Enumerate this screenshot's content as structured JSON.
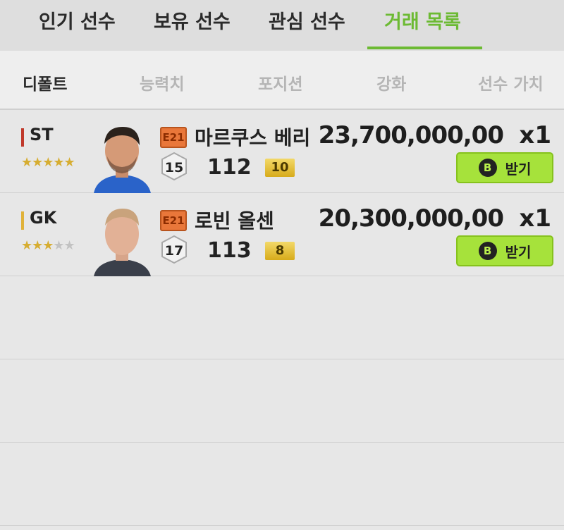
{
  "tabs": [
    {
      "label": "인기 선수",
      "active": false
    },
    {
      "label": "보유 선수",
      "active": false
    },
    {
      "label": "관심 선수",
      "active": false
    },
    {
      "label": "거래 목록",
      "active": true
    }
  ],
  "sort": [
    {
      "label": "디폴트",
      "active": true
    },
    {
      "label": "능력치",
      "active": false
    },
    {
      "label": "포지션",
      "active": false
    },
    {
      "label": "강화",
      "active": false
    },
    {
      "label": "선수 가치",
      "active": false
    }
  ],
  "colors": {
    "accent": "#6cba33",
    "button": "#a6e23b",
    "st": "#c0392b",
    "gk": "#e0b23a"
  },
  "players": [
    {
      "position": "ST",
      "position_color": "#c0392b",
      "stars": 5,
      "season": "E21",
      "name": "마르쿠스 베리",
      "salary": "15",
      "ovr": "112",
      "grade": "10",
      "price": "23,700,000,00",
      "qty": "x1",
      "button_icon": "B",
      "button_label": "받기"
    },
    {
      "position": "GK",
      "position_color": "#e0b23a",
      "stars": 3,
      "season": "E21",
      "name": "로빈 올센",
      "salary": "17",
      "ovr": "113",
      "grade": "8",
      "price": "20,300,000,00",
      "qty": "x1",
      "button_icon": "B",
      "button_label": "받기"
    }
  ]
}
